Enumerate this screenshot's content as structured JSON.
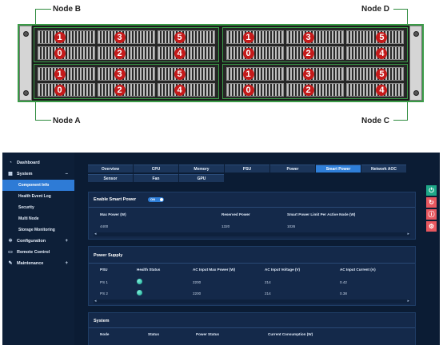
{
  "diagram": {
    "node_labels": {
      "b": "Node B",
      "d": "Node D",
      "a": "Node A",
      "c": "Node C"
    },
    "bay_numbers": [
      "0",
      "1",
      "2",
      "3",
      "4",
      "5"
    ],
    "colors": {
      "leader": "#2e8b3e",
      "badge": "#c41a1a"
    }
  },
  "sidebar": {
    "items": [
      {
        "label": "Dashboard",
        "icon": "dashboard-icon"
      },
      {
        "label": "System",
        "icon": "system-icon",
        "toggle": "–"
      },
      {
        "label": "Component Info",
        "sub": true,
        "active": true
      },
      {
        "label": "Health Event Log",
        "sub": true
      },
      {
        "label": "Security",
        "sub": true
      },
      {
        "label": "Multi Node",
        "sub": true
      },
      {
        "label": "Storage Monitoring",
        "sub": true
      },
      {
        "label": "Configuration",
        "icon": "gear-icon",
        "toggle": "+"
      },
      {
        "label": "Remote Control",
        "icon": "monitor-icon"
      },
      {
        "label": "Maintenance",
        "icon": "wrench-icon",
        "toggle": "+"
      }
    ]
  },
  "tabs": {
    "row1": [
      "Overview",
      "CPU",
      "Memory",
      "PSU",
      "Power",
      "Smart Power",
      "Network AOC"
    ],
    "row2": [
      "Sensor",
      "Fan",
      "GPU"
    ],
    "active": "Smart Power"
  },
  "smart_power": {
    "title": "Enable Smart Power",
    "toggle_text": "ON",
    "columns": [
      "Max Power (W)",
      "Reserved Power",
      "Smart Power Limit Per Active Node (W)"
    ],
    "values": [
      "4400",
      "1320",
      "1026"
    ]
  },
  "power_supply": {
    "title": "Power Supply",
    "columns": [
      "PSU",
      "Health Status",
      "AC Input Max Power (W)",
      "AC Input Voltage (V)",
      "AC Input Current (A)"
    ],
    "rows": [
      {
        "psu": "PS 1",
        "max_power": "2200",
        "voltage": "214",
        "current": "0.42"
      },
      {
        "psu": "PS 2",
        "max_power": "2200",
        "voltage": "214",
        "current": "0.38"
      }
    ]
  },
  "system": {
    "title": "System",
    "columns": [
      "Node",
      "Status",
      "Power Status",
      "Current Consumption (W)"
    ]
  },
  "float_buttons": [
    {
      "icon": "power-icon",
      "color": "#1fa888"
    },
    {
      "icon": "refresh-icon",
      "color": "#e8575f"
    },
    {
      "icon": "info-icon",
      "color": "#e8575f"
    },
    {
      "icon": "settings-icon",
      "color": "#e8575f"
    }
  ]
}
